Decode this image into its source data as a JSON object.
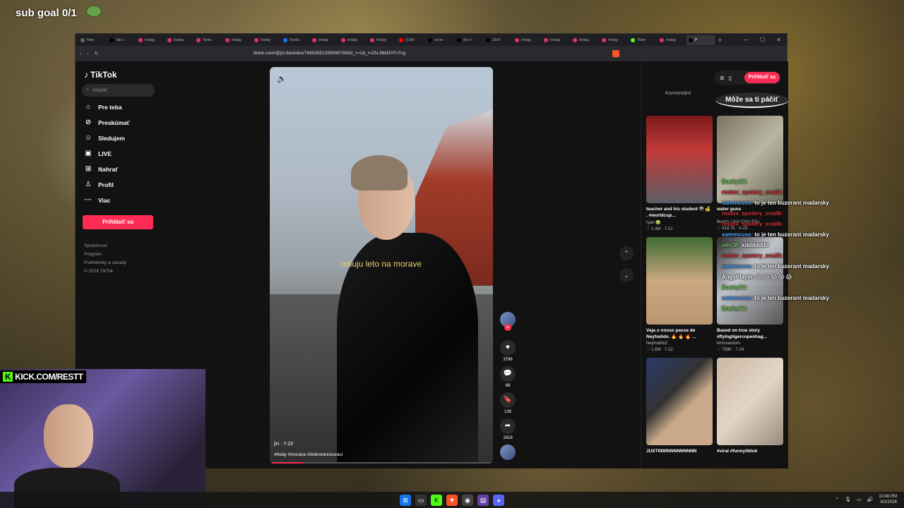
{
  "overlay": {
    "sub_goal": "sub goal 0/1",
    "kick_prefix": "K",
    "kick_url": "KICK.COM/RESTT"
  },
  "browser": {
    "tabs": [
      {
        "label": "New",
        "color": "#666"
      },
      {
        "label": "Tak s",
        "color": "#000"
      },
      {
        "label": "Instag",
        "color": "#e1306c"
      },
      {
        "label": "Instag",
        "color": "#e1306c"
      },
      {
        "label": "Tento",
        "color": "#e1306c"
      },
      {
        "label": "Instag",
        "color": "#e1306c"
      },
      {
        "label": "Instag",
        "color": "#e1306c"
      },
      {
        "label": "Faceb",
        "color": "#1877f2"
      },
      {
        "label": "Instag",
        "color": "#e1306c"
      },
      {
        "label": "Instag",
        "color": "#e1306c"
      },
      {
        "label": "Instag",
        "color": "#e1306c"
      },
      {
        "label": "(1396",
        "color": "#ff0000"
      },
      {
        "label": "na ko",
        "color": "#000"
      },
      {
        "label": "Bro n",
        "color": "#000"
      },
      {
        "label": "2014",
        "color": "#000"
      },
      {
        "label": "Instag",
        "color": "#e1306c"
      },
      {
        "label": "Instag",
        "color": "#e1306c"
      },
      {
        "label": "Instag",
        "color": "#e1306c"
      },
      {
        "label": "Instag",
        "color": "#e1306c"
      },
      {
        "label": "Tiukn",
        "color": "#53fc18"
      },
      {
        "label": "Instag",
        "color": "#e1306c"
      },
      {
        "label": "P",
        "color": "#000",
        "active": true
      }
    ],
    "url": "tiktok.com/@jiri.tla/video/7665305135609576542_r=1&_t=ZN-98kD0Tn7cg"
  },
  "tiktok": {
    "logo": "TikTok",
    "search_placeholder": "Hľadať",
    "menu": [
      {
        "label": "Pre teba",
        "icon": "⌂"
      },
      {
        "label": "Preskúmať",
        "icon": "⊘"
      },
      {
        "label": "Sledujem",
        "icon": "☺"
      },
      {
        "label": "LIVE",
        "icon": "▣"
      },
      {
        "label": "Nahrať",
        "icon": "⊞"
      },
      {
        "label": "Profil",
        "icon": "♙"
      },
      {
        "label": "Viac",
        "icon": "···"
      }
    ],
    "login_button": "Prihlásiť sa",
    "footer": [
      "Spoločnosť",
      "Program",
      "Podmienky a zásady",
      "© 2026 TikTok"
    ],
    "video": {
      "caption": "miluju leto na morave",
      "author": "jiri · 7-22",
      "tags": "#hody #morava #dobroranocuraci",
      "progress": 0.15
    },
    "actions": {
      "likes": "3796",
      "comments": "68",
      "saves": "138",
      "shares": "1818"
    },
    "right_panel": {
      "login": "Prihlásiť sa",
      "tab_comments": "Komentáre",
      "tab_suggested": "Môže sa ti páčiť",
      "cards": [
        {
          "title": "teacher and his student 😳 💰 . #worldcup...",
          "author": "ryan 🤢",
          "stats": "♡ 1.4M · 7-21",
          "thumb": "th1"
        },
        {
          "title": "water guns",
          "author": "Bướm Lành Chim Đậu",
          "stats": "♡ 419.7K · 6-29",
          "thumb": "th2"
        },
        {
          "title": "Veja o nosso passe de Neyfodido. 🔥 🔥 🔥 ...",
          "author": "Neyfudido2",
          "stats": "♡ 1.6M · 7-22",
          "thumb": "th3"
        },
        {
          "title": "Based on true story #flyingtigercopenhag...",
          "author": "kimorandom",
          "stats": "♡ 758K · 7-24",
          "thumb": "th4"
        },
        {
          "title": "JUSTIIIIIIINNNNNNNNN",
          "author": "",
          "stats": "",
          "thumb": "th5"
        },
        {
          "title": "#viral #funnytiktok",
          "author": "",
          "stats": "",
          "thumb": "th6"
        }
      ]
    }
  },
  "chat": [
    {
      "user": "Bushy64:",
      "msg": "",
      "cls": "u-green"
    },
    {
      "user": "restov_spotery_snallk:",
      "msg": "",
      "cls": "u-red"
    },
    {
      "user": "sammcuss:",
      "msg": "to je ten buzerant madarsky",
      "cls": "u-blue"
    },
    {
      "user": "restov_spotery_snallk:",
      "msg": "",
      "cls": "u-red"
    },
    {
      "user": "restov_spotery_snallk:",
      "msg": "",
      "cls": "u-red"
    },
    {
      "user": "sammcuss:",
      "msg": "to je ten buzerant madarsky",
      "cls": "u-blue"
    },
    {
      "user": "olin38:",
      "msg": "xddddddd",
      "cls": "u-green"
    },
    {
      "user": "restov_spotery_snallk:",
      "msg": "",
      "cls": "u-red"
    },
    {
      "user": "sammcuss:",
      "msg": "to je ten buzerant madarsky",
      "cls": "u-blue"
    },
    {
      "user": "AngyPlayin:",
      "msg": "😱 😱 😱 😱 😱",
      "cls": "u-white"
    },
    {
      "user": "Bushy64:",
      "msg": "",
      "cls": "u-green"
    },
    {
      "user": "sammcuss:",
      "msg": "to je ten buzerant madarsky",
      "cls": "u-blue"
    },
    {
      "user": "Bushy64:",
      "msg": "",
      "cls": "u-green"
    }
  ],
  "taskbar": {
    "time": "10:46 PM",
    "date": "8/2/2026"
  }
}
